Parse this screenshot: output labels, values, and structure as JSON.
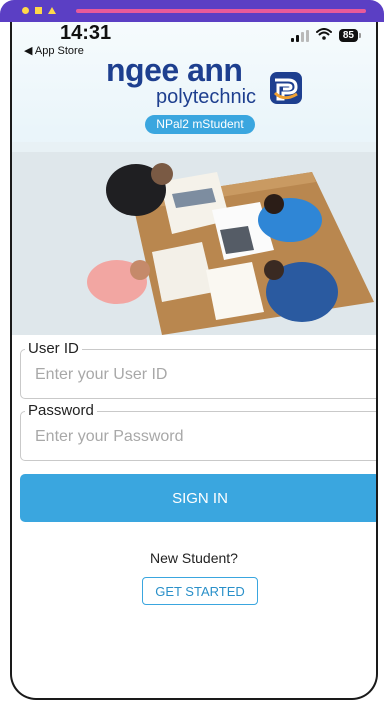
{
  "status_bar": {
    "time": "14:31",
    "back_label": "◀ App Store",
    "battery": "85",
    "wifi_icon": "wifi-icon"
  },
  "brand": {
    "name": "ngee ann",
    "subtitle": "polytechnic",
    "app_name": "NPal2 mStudent"
  },
  "form": {
    "user_id": {
      "label": "User ID",
      "value": "",
      "placeholder": "Enter your User ID"
    },
    "password": {
      "label": "Password",
      "value": "",
      "placeholder": "Enter your Password"
    },
    "signin_label": "SIGN IN"
  },
  "new_student": {
    "prompt": "New Student?",
    "button_label": "GET STARTED"
  },
  "colors": {
    "accent": "#3aa6df",
    "brand_navy": "#1e3f8f",
    "window_strip": "#5b3fc4"
  }
}
